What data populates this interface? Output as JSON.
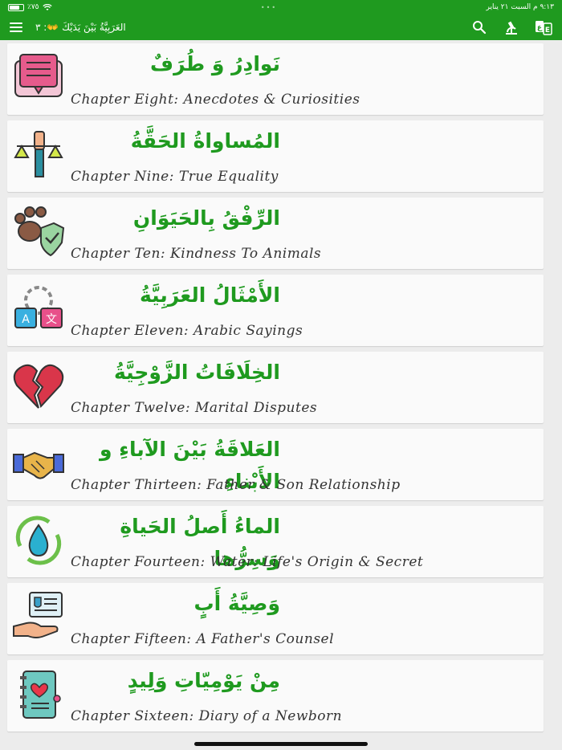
{
  "status_bar": {
    "time_date": "٩:١٣ م  السبت ٢١ يناير",
    "battery": "٪٧٥"
  },
  "toolbar": {
    "title": "العَرَبِيَّةُ بَيْنَ يَدَيْكَ 👐: ٣"
  },
  "chapters": [
    {
      "ar": "نَوادِرُ وَ طُرَفٌ",
      "en": "Chapter Eight: Anecdotes & Curiosities",
      "icon": "book-icon",
      "color": "#e0457a"
    },
    {
      "ar": "المُساواةُ الحَقَّةُ",
      "en": "Chapter Nine: True Equality",
      "icon": "scales-icon",
      "color": "#2a8fa0"
    },
    {
      "ar": "الرِّفْقُ بِالحَيَوَانِ",
      "en": "Chapter Ten: Kindness To Animals",
      "icon": "paw-shield-icon",
      "color": "#6a4a3a"
    },
    {
      "ar": "الأَمْثَالُ العَرَبِيَّةُ",
      "en": "Chapter Eleven: Arabic Sayings",
      "icon": "translate-icon",
      "color": "#2a8fcf"
    },
    {
      "ar": "الخِلَافَاتُ الزَّوْجِيَّةُ",
      "en": "Chapter Twelve: Marital Disputes",
      "icon": "broken-heart-icon",
      "color": "#d83a4a"
    },
    {
      "ar": "العَلاقَةُ بَيْنَ الآباءِ و الأَبْناءِ",
      "en": "Chapter Thirteen: Father & Son Relationship",
      "icon": "handshake-icon",
      "color": "#e6a52a"
    },
    {
      "ar": "الماءُ أَصلُ الحَياةِ وَسِرُّها",
      "en": "Chapter Fourteen: Water: Life's Origin & Secret",
      "icon": "water-drop-icon",
      "color": "#2ab0d0"
    },
    {
      "ar": "وَصِيَّةُ أَبٍ",
      "en": "Chapter Fifteen: A Father's Counsel",
      "icon": "hand-message-icon",
      "color": "#3aa0c8"
    },
    {
      "ar": "مِنْ يَوْمِيّاتِ وَلِيدٍ",
      "en": "Chapter Sixteen: Diary of a Newborn",
      "icon": "diary-icon",
      "color": "#58b8b0"
    }
  ]
}
